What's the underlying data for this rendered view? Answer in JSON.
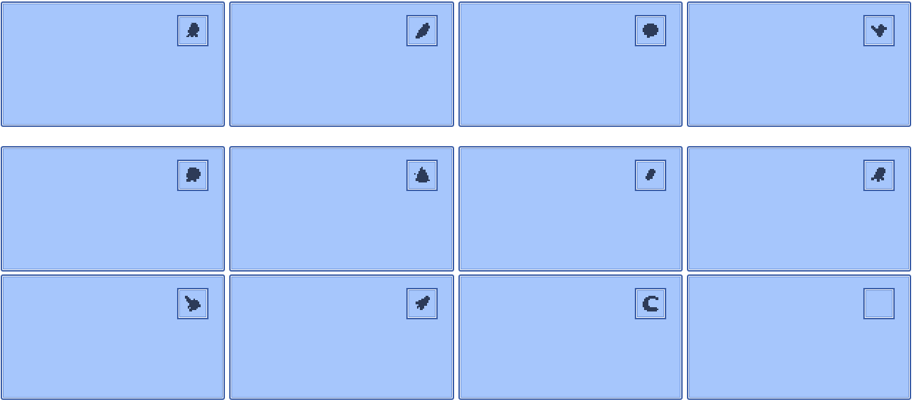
{
  "colors": {
    "panel_fill": "#a6c6fc",
    "panel_border": "#3c5fa8",
    "silhouette": "#2d3b58",
    "background": "#ffffff"
  },
  "slots": [
    {
      "id": 1,
      "icon": "frog-silhouette-icon"
    },
    {
      "id": 2,
      "icon": "leaf-silhouette-icon"
    },
    {
      "id": 3,
      "icon": "blob-silhouette-icon"
    },
    {
      "id": 4,
      "icon": "bird-silhouette-icon"
    },
    {
      "id": 5,
      "icon": "creature-silhouette-icon"
    },
    {
      "id": 6,
      "icon": "squirrel-silhouette-icon"
    },
    {
      "id": 7,
      "icon": "small-bird-silhouette-icon"
    },
    {
      "id": 8,
      "icon": "monkey-silhouette-icon"
    },
    {
      "id": 9,
      "icon": "dragon-silhouette-icon"
    },
    {
      "id": 10,
      "icon": "fish-silhouette-icon"
    },
    {
      "id": 11,
      "icon": "worm-silhouette-icon"
    },
    {
      "id": 12,
      "icon": "empty-slot-icon"
    }
  ]
}
